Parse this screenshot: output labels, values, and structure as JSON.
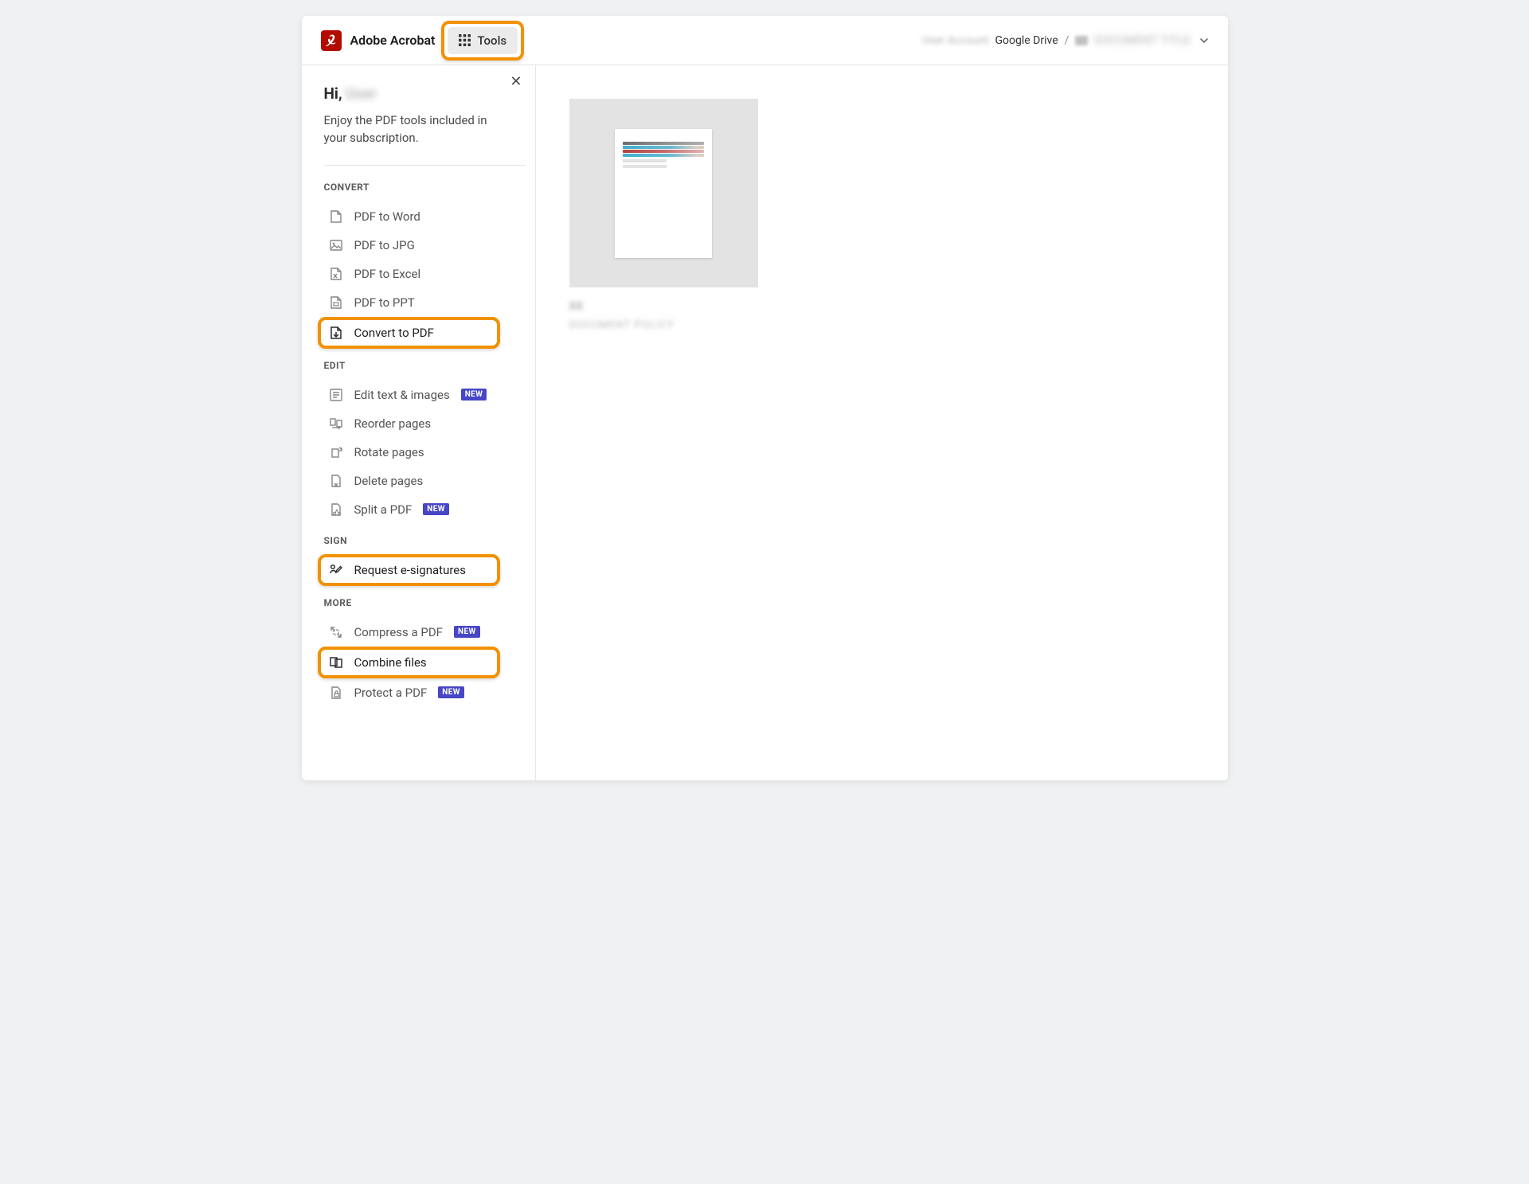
{
  "header": {
    "brand_name": "Adobe Acrobat",
    "tools_label": "Tools",
    "breadcrumbs": {
      "account_blur": "User Account",
      "drive": "Google Drive",
      "file_blur": "DOCUMENT TITLE"
    }
  },
  "sidebar": {
    "greeting_prefix": "Hi,",
    "greeting_name": "User",
    "greeting_desc": "Enjoy the PDF tools included in your subscription.",
    "sections": {
      "convert": {
        "label": "CONVERT",
        "items": [
          {
            "id": "pdf-to-word",
            "label": "PDF to Word"
          },
          {
            "id": "pdf-to-jpg",
            "label": "PDF to JPG"
          },
          {
            "id": "pdf-to-excel",
            "label": "PDF to Excel"
          },
          {
            "id": "pdf-to-ppt",
            "label": "PDF to PPT"
          },
          {
            "id": "convert-to-pdf",
            "label": "Convert to PDF",
            "highlighted": true
          }
        ]
      },
      "edit": {
        "label": "EDIT",
        "items": [
          {
            "id": "edit-text-images",
            "label": "Edit text & images",
            "badge": "NEW"
          },
          {
            "id": "reorder-pages",
            "label": "Reorder pages"
          },
          {
            "id": "rotate-pages",
            "label": "Rotate pages"
          },
          {
            "id": "delete-pages",
            "label": "Delete pages"
          },
          {
            "id": "split-pdf",
            "label": "Split a PDF",
            "badge": "NEW"
          }
        ]
      },
      "sign": {
        "label": "SIGN",
        "items": [
          {
            "id": "request-esignatures",
            "label": "Request e-signatures",
            "highlighted": true
          }
        ]
      },
      "more": {
        "label": "MORE",
        "items": [
          {
            "id": "compress-pdf",
            "label": "Compress a PDF",
            "badge": "NEW"
          },
          {
            "id": "combine-files",
            "label": "Combine files",
            "highlighted": true
          },
          {
            "id": "protect-pdf",
            "label": "Protect a PDF",
            "badge": "NEW"
          }
        ]
      }
    }
  },
  "main": {
    "file_code_blur": "XX",
    "file_title_blur": "DOCUMENT POLICY"
  }
}
